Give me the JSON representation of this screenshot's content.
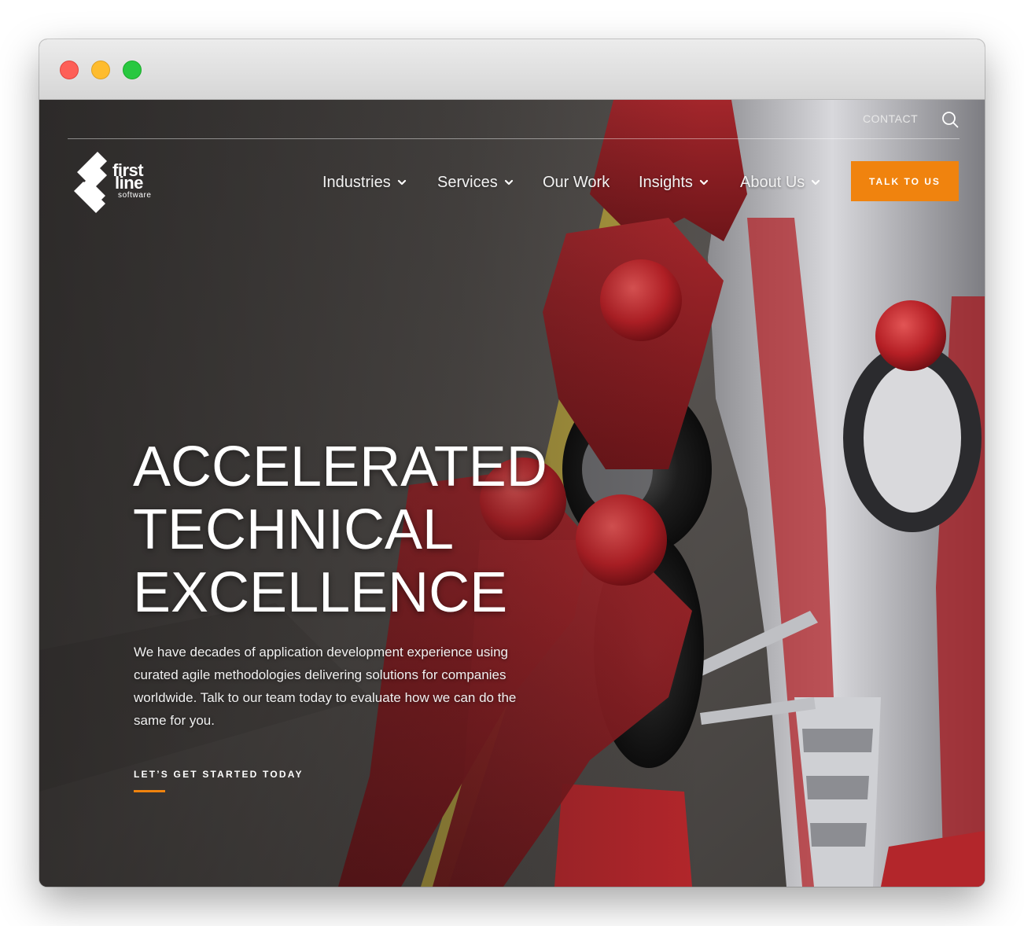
{
  "brand": {
    "logo_word1": "first",
    "logo_word2": "line",
    "logo_word3": "software",
    "accent_color": "#f0830e"
  },
  "utility_bar": {
    "contact_label": "CONTACT",
    "search_icon": "search-icon"
  },
  "nav": {
    "items": [
      {
        "label": "Industries",
        "has_dropdown": true
      },
      {
        "label": "Services",
        "has_dropdown": true
      },
      {
        "label": "Our Work",
        "has_dropdown": false
      },
      {
        "label": "Insights",
        "has_dropdown": true
      },
      {
        "label": "About Us",
        "has_dropdown": true
      }
    ],
    "cta_label": "TALK TO US"
  },
  "hero": {
    "headline_lines": [
      "ACCELERATED",
      "TECHNICAL",
      "EXCELLENCE"
    ],
    "lead": "We have decades of application development experience using curated agile methodologies delivering solutions for companies worldwide. Talk to our team today to evaluate how we can do the same for you.",
    "cta_link": "LET’S GET STARTED TODAY"
  }
}
